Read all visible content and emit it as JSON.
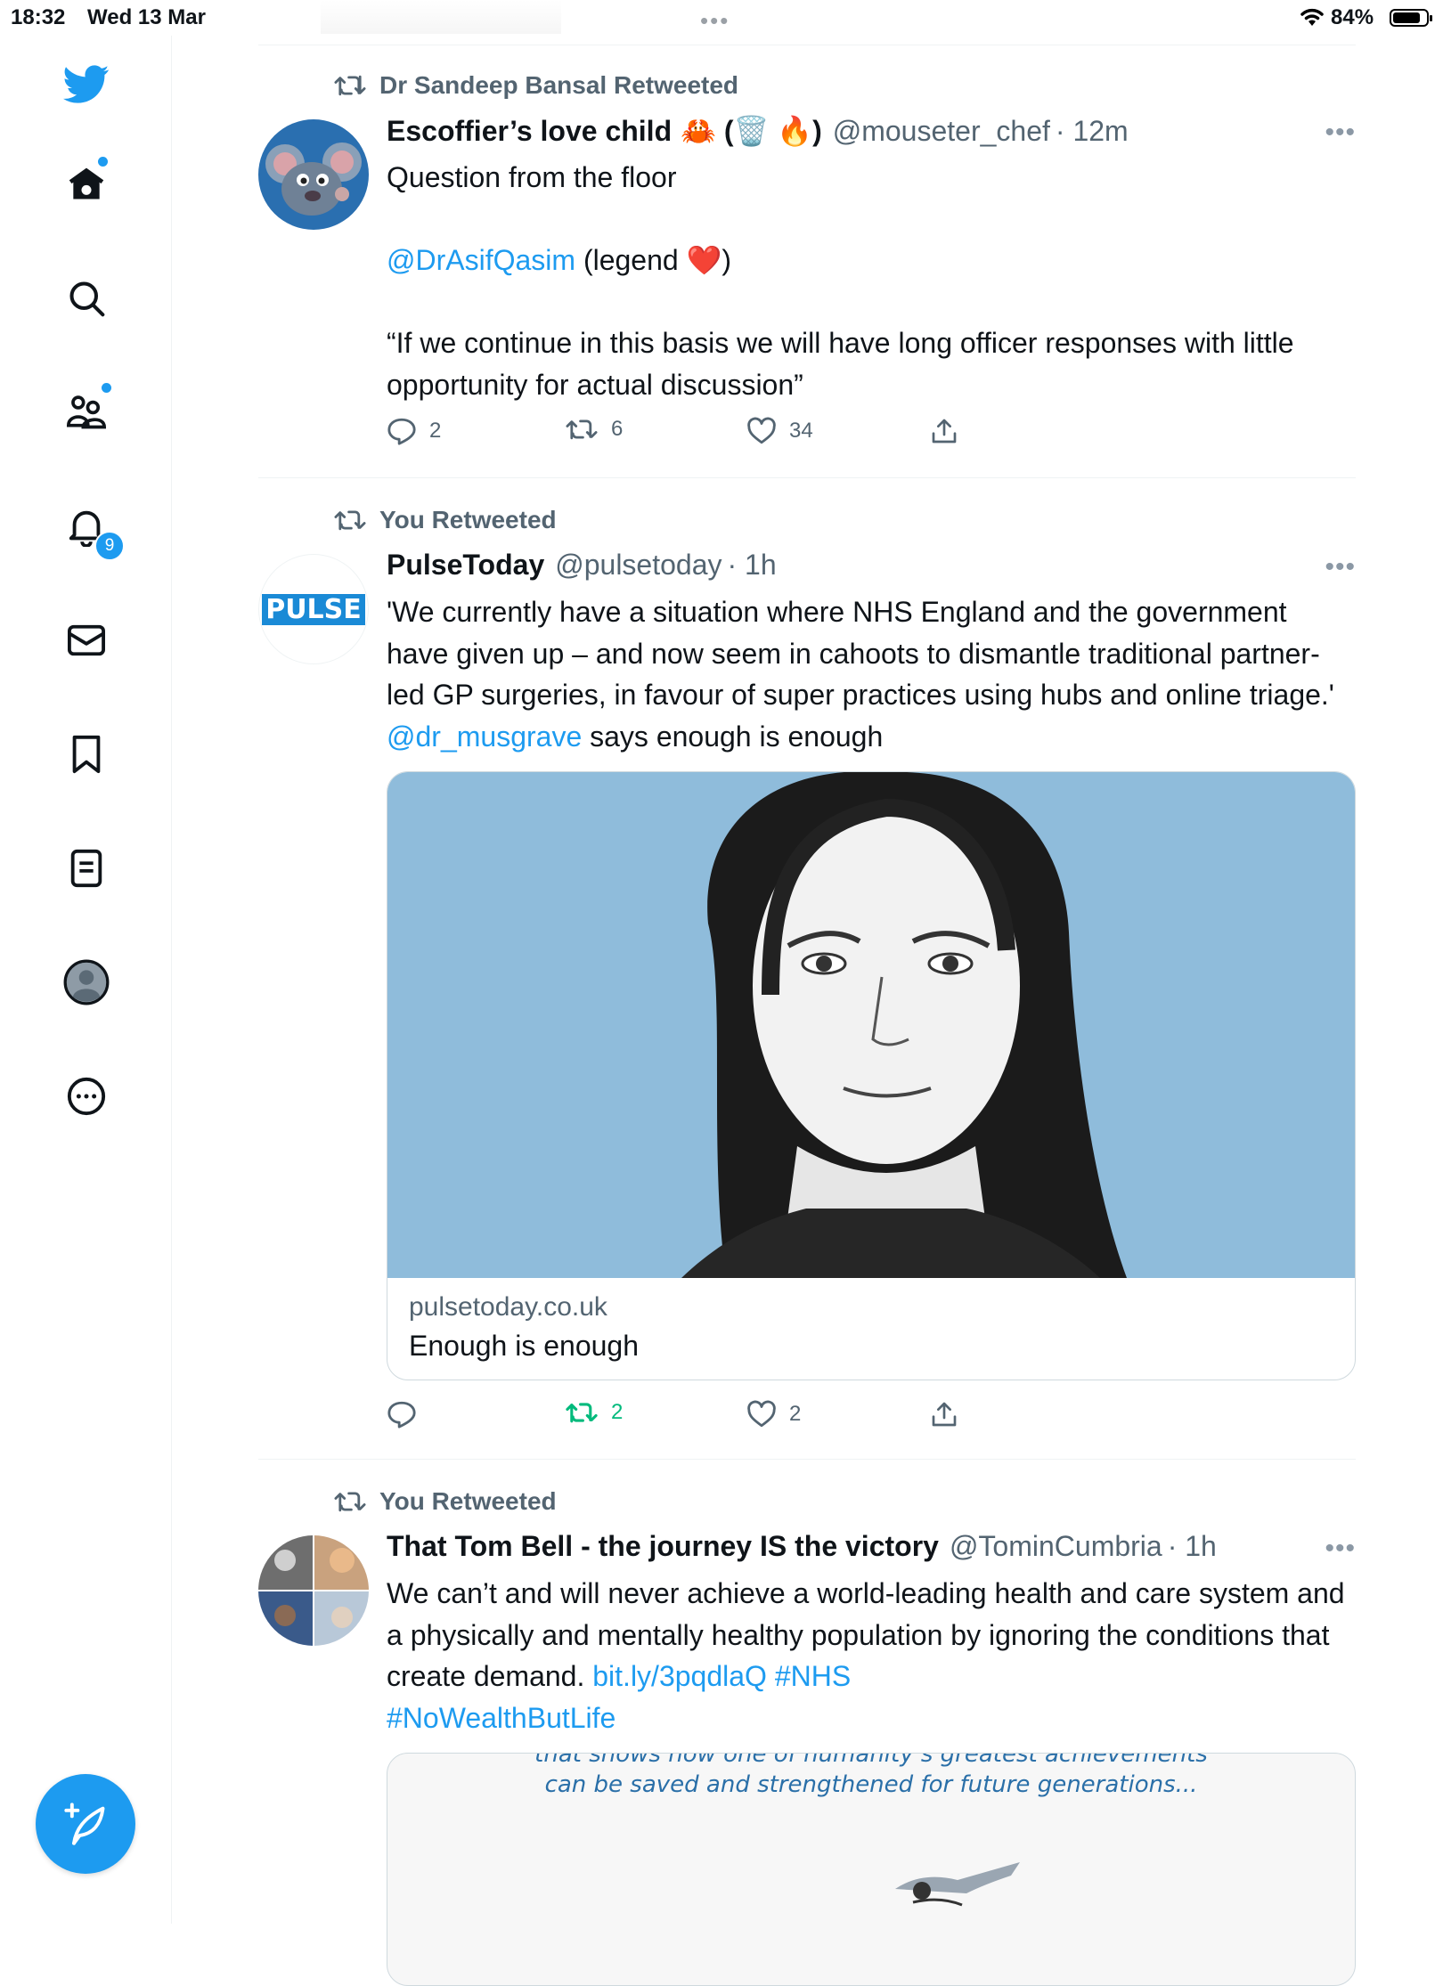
{
  "status_bar": {
    "time": "18:32",
    "date": "Wed 13 Mar",
    "battery": "84%"
  },
  "sidebar": {
    "items": [
      {
        "icon": "twitter-logo-icon"
      },
      {
        "icon": "home-icon"
      },
      {
        "icon": "search-icon"
      },
      {
        "icon": "communities-icon"
      },
      {
        "icon": "notifications-icon",
        "badge": "9"
      },
      {
        "icon": "messages-icon"
      },
      {
        "icon": "bookmarks-icon"
      },
      {
        "icon": "lists-icon"
      },
      {
        "icon": "profile-icon"
      },
      {
        "icon": "more-icon"
      }
    ],
    "compose_icon": "compose-feather-icon",
    "accent": "#1d9bf0"
  },
  "tweets": [
    {
      "retweeted_by": "Dr Sandeep Bansal Retweeted",
      "name": "Escoffier’s love child",
      "name_emoji": "🦀 (🗑️ 🔥)",
      "handle": "@mouseter_chef",
      "time": "· 12m",
      "text_1": "Question from the floor",
      "mention": "@DrAsifQasim",
      "text_2": " (legend ❤️)",
      "text_3": "“If we continue in this basis we will have long officer responses with little opportunity for actual discussion”",
      "replies": "2",
      "retweets": "6",
      "likes": "34"
    },
    {
      "retweeted_by": "You Retweeted",
      "name": "PulseToday",
      "handle": "@pulsetoday",
      "time": "· 1h",
      "avatar_text": "PULSE",
      "text": "'We currently have a situation where NHS England and the government have given up – and now seem in cahoots to dismantle traditional partner-led GP surgeries, in favour of super practices using hubs and online triage.' ",
      "mention": "@dr_musgrave",
      "text_end": " says enough is enough",
      "card_domain": "pulsetoday.co.uk",
      "card_title": "Enough is enough",
      "replies": "",
      "retweets": "2",
      "likes": "2"
    },
    {
      "retweeted_by": "You Retweeted",
      "name": "That Tom Bell - the journey IS the victory",
      "handle": "@TominCumbria",
      "time": "· 1h",
      "text": "We can’t and will never achieve a world-leading health and care system and a physically and mentally healthy population by ignoring the conditions that create demand. ",
      "link": "bit.ly/3pqdlaQ",
      "hashtag_1": " #NHS",
      "hashtag_2": "#NoWealthButLife",
      "card_text_1": "that shows how one of humanity’s greatest achievements",
      "card_text_2": "can be saved and strengthened for future generations..."
    }
  ]
}
